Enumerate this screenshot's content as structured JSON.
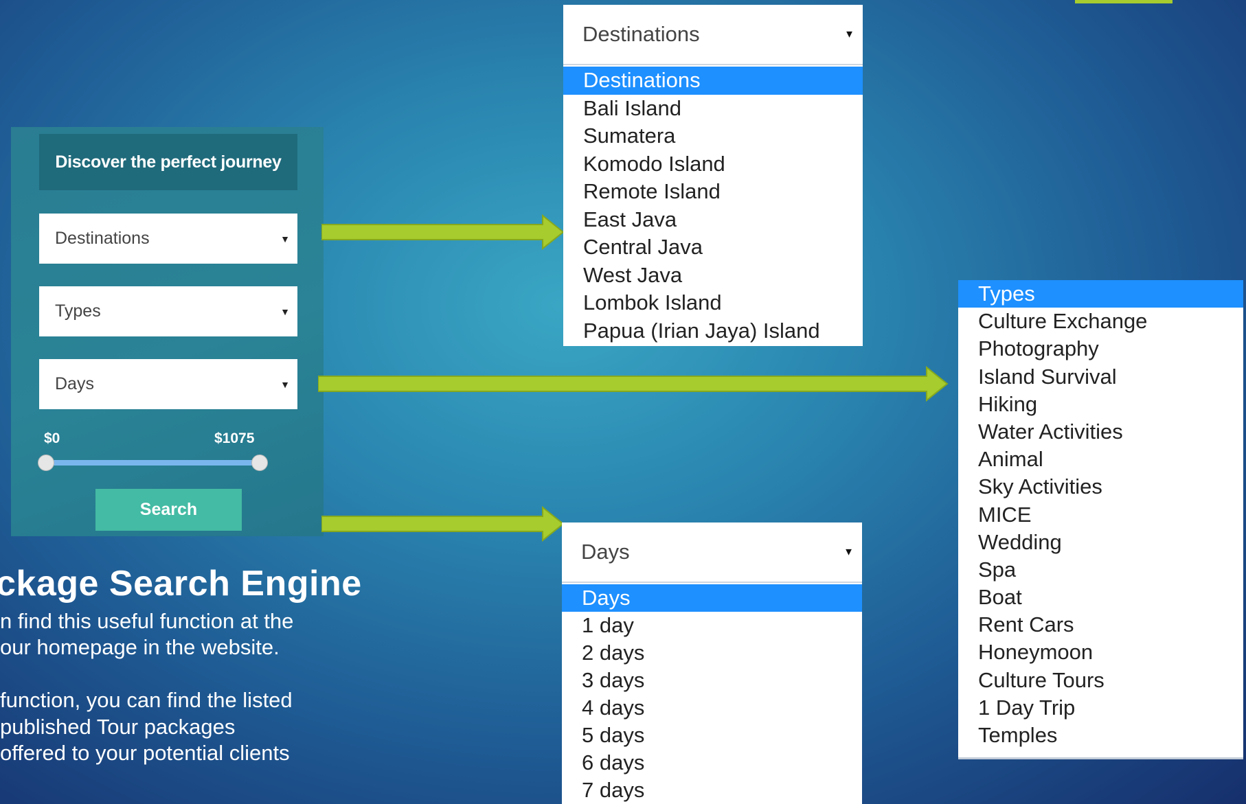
{
  "colors": {
    "accent_green": "#a6cc2e",
    "selected_blue": "#1e90ff",
    "search_button": "#44bba4",
    "widget_header": "#1f6a7b"
  },
  "widget": {
    "header": "Discover the perfect journey",
    "destinations_select": "Destinations",
    "types_select": "Types",
    "days_select": "Days",
    "price_min": "$0",
    "price_max": "$1075",
    "search_label": "Search"
  },
  "text": {
    "title": "ckage Search Engine",
    "line1": "n find this useful function at the",
    "line2": "our homepage in the website.",
    "line3": " function, you can find the listed",
    "line4": "published Tour packages",
    "line5": "offered to your potential clients"
  },
  "destinations_dropdown": {
    "header": "Destinations",
    "options": [
      "Destinations",
      "Bali Island",
      "Sumatera",
      "Komodo Island",
      "Remote Island",
      "East Java",
      "Central Java",
      "West Java",
      "Lombok Island",
      "Papua (Irian Jaya) Island"
    ],
    "selected": "Destinations"
  },
  "days_dropdown": {
    "header": "Days",
    "options": [
      "Days",
      "1 day",
      "2 days",
      "3 days",
      "4 days",
      "5 days",
      "6 days",
      "7 days"
    ],
    "selected": "Days"
  },
  "types_dropdown": {
    "options": [
      "Types",
      "Culture Exchange",
      "Photography",
      "Island Survival",
      "Hiking",
      "Water Activities",
      "Animal",
      "Sky Activities",
      "MICE",
      "Wedding",
      "Spa",
      "Boat",
      "Rent Cars",
      "Honeymoon",
      "Culture Tours",
      "1 Day Trip",
      "Temples"
    ],
    "selected": "Types"
  },
  "icons": {
    "caret": "▼"
  }
}
